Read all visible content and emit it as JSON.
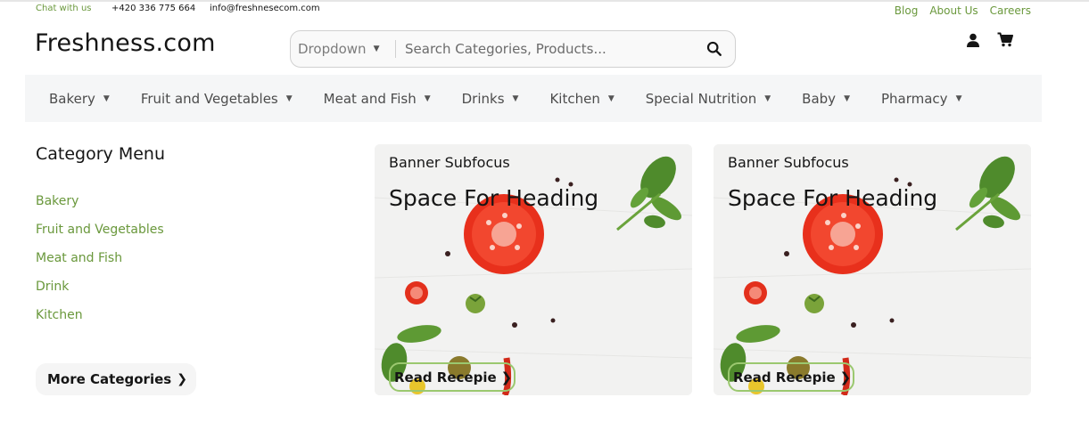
{
  "topbar": {
    "chat": "Chat with us",
    "phone": "+420 336 775 664",
    "email": "info@freshnesecom.com",
    "links": [
      "Blog",
      "About Us",
      "Careers"
    ]
  },
  "header": {
    "logo": "Freshness.com",
    "search_dropdown": "Dropdown",
    "search_placeholder": "Search Categories, Products...",
    "icons": [
      "search-icon",
      "user-icon",
      "cart-icon"
    ]
  },
  "nav": {
    "items": [
      "Bakery",
      "Fruit and Vegetables",
      "Meat and Fish",
      "Drinks",
      "Kitchen",
      "Special Nutrition",
      "Baby",
      "Pharmacy"
    ]
  },
  "sidebar": {
    "title": "Category Menu",
    "items": [
      "Bakery",
      "Fruit and Vegetables",
      "Meat and Fish",
      "Drink",
      "Kitchen"
    ],
    "more_label": "More Categories"
  },
  "banners": [
    {
      "subfocus": "Banner Subfocus",
      "heading": "Space For Heading",
      "cta": "Read Recepie"
    },
    {
      "subfocus": "Banner Subfocus",
      "heading": "Space For Heading",
      "cta": "Read Recepie"
    }
  ],
  "colors": {
    "accent": "#6a983c",
    "accent_border": "#9bc86f",
    "nav_bg": "#f5f6f7",
    "text": "#151515"
  }
}
